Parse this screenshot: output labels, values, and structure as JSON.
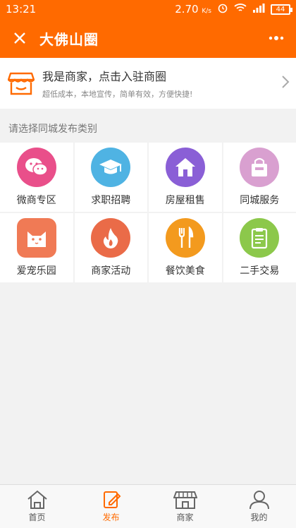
{
  "status": {
    "time": "13:21",
    "speed_value": "2.70",
    "speed_unit": "K/s",
    "battery": "44"
  },
  "header": {
    "title": "大佛山圈",
    "close_icon": "close-icon",
    "more_icon": "more-icon"
  },
  "banner": {
    "title": "我是商家，点击入驻商圈",
    "subtitle": "超低成本，本地宣传，简单有效，方便快捷!"
  },
  "section_label": "请选择同城发布类别",
  "categories": [
    {
      "label": "微商专区",
      "color": "#e94f8a",
      "icon": "wechat-icon"
    },
    {
      "label": "求职招聘",
      "color": "#4fb3e3",
      "icon": "graduation-cap-icon"
    },
    {
      "label": "房屋租售",
      "color": "#8a5fd6",
      "icon": "house-icon"
    },
    {
      "label": "同城服务",
      "color": "#d9a0d0",
      "icon": "bag-icon"
    },
    {
      "label": "爱宠乐园",
      "color": "#f07a55",
      "icon": "cat-icon"
    },
    {
      "label": "商家活动",
      "color": "#ea6b48",
      "icon": "flame-icon"
    },
    {
      "label": "餐饮美食",
      "color": "#f39a1e",
      "icon": "fork-knife-icon"
    },
    {
      "label": "二手交易",
      "color": "#8cc84b",
      "icon": "clipboard-icon"
    }
  ],
  "tabs": [
    {
      "label": "首页",
      "icon": "home-icon",
      "active": false
    },
    {
      "label": "发布",
      "icon": "edit-icon",
      "active": true
    },
    {
      "label": "商家",
      "icon": "store-icon",
      "active": false
    },
    {
      "label": "我的",
      "icon": "user-icon",
      "active": false
    }
  ],
  "colors": {
    "brand": "#ff6a00",
    "tab_active": "#ff6a00"
  }
}
